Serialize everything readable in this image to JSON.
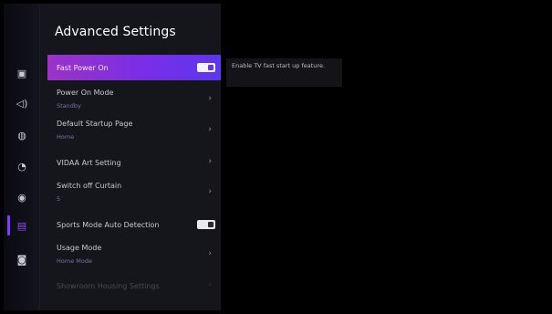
{
  "page": {
    "title": "Advanced Settings"
  },
  "sidebar": {
    "items": [
      {
        "icon": "picture-icon",
        "glyph": "▣",
        "active": false
      },
      {
        "icon": "sound-icon",
        "glyph": "◁)",
        "active": false
      },
      {
        "icon": "network-icon",
        "glyph": "◍",
        "active": false
      },
      {
        "icon": "general-icon",
        "glyph": "◔",
        "active": false
      },
      {
        "icon": "accessibility-icon",
        "glyph": "◉",
        "active": false
      },
      {
        "icon": "system-icon",
        "glyph": "▤",
        "active": true
      },
      {
        "icon": "support-icon",
        "glyph": "◙",
        "active": false
      }
    ]
  },
  "settings": {
    "items": [
      {
        "label": "Fast Power On",
        "sub": "",
        "control": "toggle",
        "state": "on",
        "focused": true
      },
      {
        "label": "Power On Mode",
        "sub": "Standby",
        "control": "chevron"
      },
      {
        "label": "Default Startup Page",
        "sub": "Home",
        "control": "chevron"
      },
      {
        "label": "VIDAA Art Setting",
        "sub": "",
        "control": "chevron"
      },
      {
        "label": "Switch off Curtain",
        "sub": "5",
        "control": "chevron"
      },
      {
        "label": "Sports Mode Auto Detection",
        "sub": "",
        "control": "toggle",
        "state": "off"
      },
      {
        "label": "Usage Mode",
        "sub": "Home Mode",
        "control": "chevron"
      },
      {
        "label": "Showroom Housing Settings",
        "sub": "",
        "control": "chevron",
        "disabled": true
      }
    ],
    "chevron_glyph": "›"
  },
  "help": {
    "text": "Enable TV fast start up feature."
  },
  "colors": {
    "accent_start": "#9b33c7",
    "accent_end": "#5d36f0",
    "panel_bg": "#15151c",
    "subtitle": "#7b6fa8"
  }
}
